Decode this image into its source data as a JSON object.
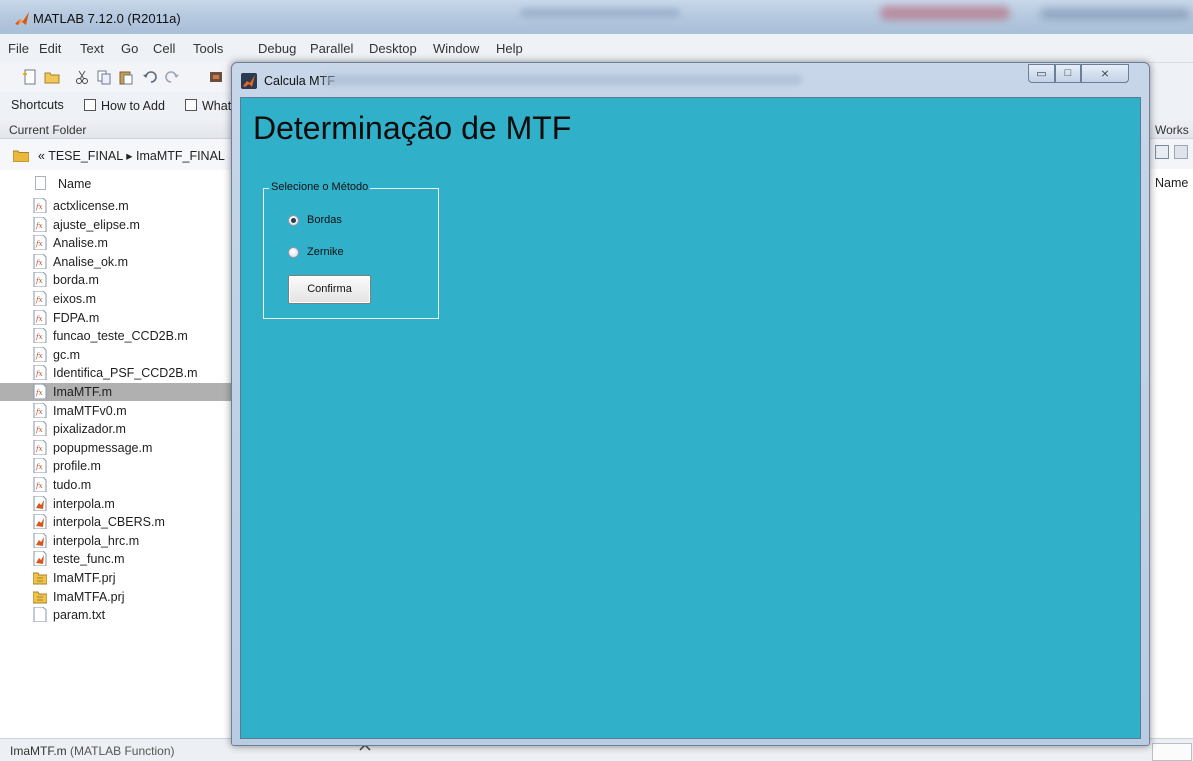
{
  "app": {
    "title": "MATLAB  7.12.0 (R2011a)"
  },
  "menubar": [
    "File",
    "Edit",
    "Text",
    "Go",
    "Cell",
    "Tools",
    "Debug",
    "Parallel",
    "Desktop",
    "Window",
    "Help"
  ],
  "shortcuts": {
    "shortcuts_label": "Shortcuts",
    "how_to_add": "How to Add",
    "whats_new": "What's New"
  },
  "current_folder": {
    "header": "Current Folder",
    "path": "«  TESE_FINAL  ▸  ImaMTF_FINAL",
    "column_name": "Name",
    "files": [
      {
        "name": "actxlicense.m",
        "icon": "mfile-function-icon"
      },
      {
        "name": "ajuste_elipse.m",
        "icon": "mfile-function-icon"
      },
      {
        "name": "Analise.m",
        "icon": "mfile-function-icon"
      },
      {
        "name": "Analise_ok.m",
        "icon": "mfile-function-icon"
      },
      {
        "name": "borda.m",
        "icon": "mfile-function-icon"
      },
      {
        "name": "eixos.m",
        "icon": "mfile-function-icon"
      },
      {
        "name": "FDPA.m",
        "icon": "mfile-function-icon"
      },
      {
        "name": "funcao_teste_CCD2B.m",
        "icon": "mfile-function-icon"
      },
      {
        "name": "gc.m",
        "icon": "mfile-function-icon"
      },
      {
        "name": "Identifica_PSF_CCD2B.m",
        "icon": "mfile-function-icon"
      },
      {
        "name": "ImaMTF.m",
        "icon": "mfile-function-icon",
        "selected": true
      },
      {
        "name": "ImaMTFv0.m",
        "icon": "mfile-function-icon"
      },
      {
        "name": "pixalizador.m",
        "icon": "mfile-function-icon"
      },
      {
        "name": "popupmessage.m",
        "icon": "mfile-function-icon"
      },
      {
        "name": "profile.m",
        "icon": "mfile-function-icon"
      },
      {
        "name": "tudo.m",
        "icon": "mfile-function-icon"
      },
      {
        "name": "interpola.m",
        "icon": "mfile-script-icon"
      },
      {
        "name": "interpola_CBERS.m",
        "icon": "mfile-script-icon"
      },
      {
        "name": "interpola_hrc.m",
        "icon": "mfile-script-icon"
      },
      {
        "name": "teste_func.m",
        "icon": "mfile-script-icon"
      },
      {
        "name": "ImaMTF.prj",
        "icon": "project-icon"
      },
      {
        "name": "ImaMTFA.prj",
        "icon": "project-icon"
      },
      {
        "name": "param.txt",
        "icon": "text-file-icon"
      }
    ]
  },
  "workspace": {
    "header": "Works",
    "column_name": "Name"
  },
  "statusbar": {
    "file": "ImaMTF.m",
    "file_type": "(MATLAB Function)"
  },
  "figure_window": {
    "title": "Calcula MTF",
    "heading": "Determinação de MTF",
    "group_title": "Selecione o Método",
    "options": [
      {
        "label": "Bordas",
        "selected": true
      },
      {
        "label": "Zernike",
        "selected": false
      }
    ],
    "confirm_label": "Confirma",
    "controls": {
      "minimize": "▭",
      "maximize": "□",
      "close": "⨯"
    }
  },
  "colors": {
    "figure_background": "#31b0c9",
    "selection": "#b0b0b0",
    "titlebar": "#b9cce2"
  }
}
